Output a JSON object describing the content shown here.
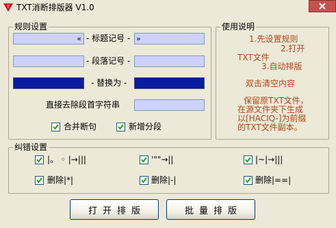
{
  "window": {
    "title": "TXT消断排版器 V1.0"
  },
  "rules": {
    "group_title": "规则设置",
    "title_mark": {
      "label": "- 标题记号 -",
      "left_value": "«",
      "right_value": "»"
    },
    "paragraph_mark": {
      "label": "- 段落记号 -",
      "left_value": "",
      "right_value": ""
    },
    "replace": {
      "label": "- 替换为 -",
      "left_value": "",
      "right_value": ""
    },
    "strip_first_chars": {
      "label": "直接去除段首字符串",
      "value": ""
    },
    "merge_breaks": {
      "label": "合并断句",
      "checked": true
    },
    "add_paragraphs": {
      "label": "新增分段",
      "checked": true
    }
  },
  "usage": {
    "group_title": "使用说明",
    "lines": [
      "1.先设置规则",
      "2.打开",
      "TXT文件",
      "3.自动排版",
      "双击清空内容",
      "保留原TXT文件，",
      "在源文件夹下生成",
      "以[HACIQ-]为前缀",
      "的TXT文件副本。"
    ]
  },
  "errors": {
    "group_title": "纠错设置",
    "items": [
      {
        "label": "|。 ◦ |→|||",
        "checked": true
      },
      {
        "label": "'\"\"→||",
        "checked": true
      },
      {
        "label": "|~|→|||",
        "checked": true
      },
      {
        "label": "删除|*|",
        "checked": true
      },
      {
        "label": "删除|-|",
        "checked": true
      },
      {
        "label": "删除|==|",
        "checked": true
      }
    ]
  },
  "actions": {
    "open_label": "打开排版",
    "batch_label": "批量排版"
  },
  "colors": {
    "field_fill": "#cdd1ff",
    "field_dark": "#0a1ca0",
    "note_text": "#b2461a",
    "close_button": "#c6524f"
  }
}
